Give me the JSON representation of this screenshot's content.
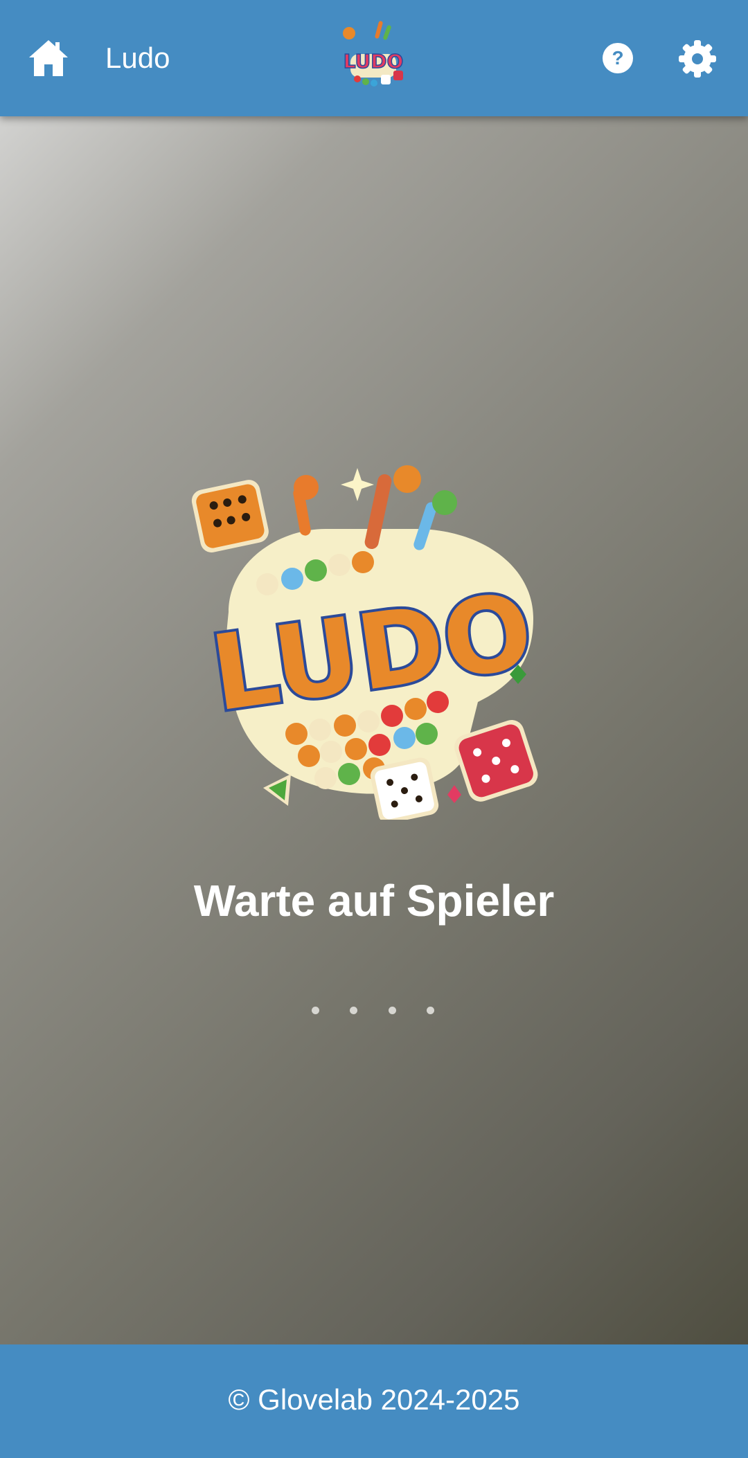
{
  "header": {
    "title": "Ludo",
    "home_icon": "home-icon",
    "help_icon": "help-icon",
    "settings_icon": "gear-icon",
    "logo_text": "LUDO"
  },
  "main": {
    "logo_text": "LUDO",
    "status_text": "Warte auf Spieler",
    "loading_dots": 4
  },
  "footer": {
    "copyright": "© Glovelab 2024-2025"
  },
  "colors": {
    "bar": "#458cc2",
    "text": "#ffffff",
    "gradient_start": "#d2d2d0",
    "gradient_end": "#4f4e40"
  }
}
